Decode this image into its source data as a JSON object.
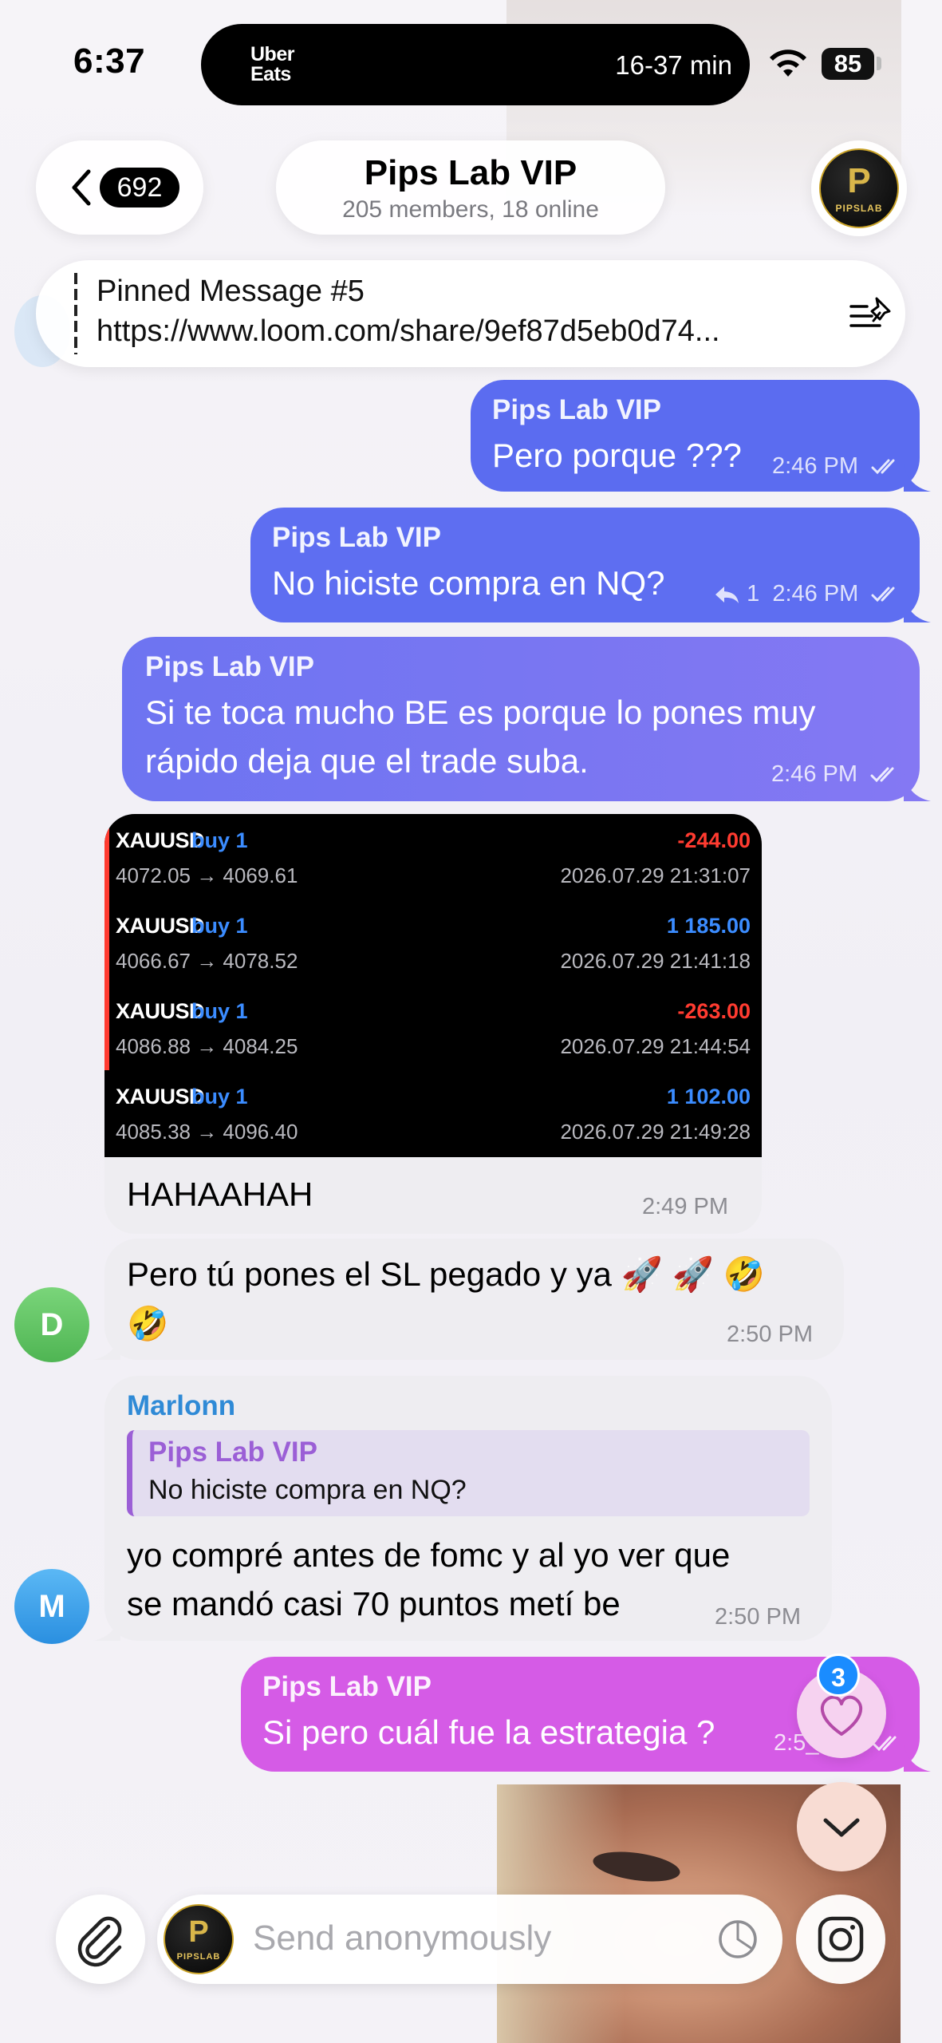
{
  "status_bar": {
    "time": "6:37",
    "live_activity_app": "Uber Eats",
    "eta": "16-37 min",
    "battery": "85"
  },
  "header": {
    "back_count": "692",
    "title": "Pips Lab VIP",
    "subtitle": "205 members, 18 online",
    "avatar_text": "PIPSLAB"
  },
  "pinned": {
    "title": "Pinned Message #5",
    "text": "https://www.loom.com/share/9ef87d5eb0d74..."
  },
  "messages": {
    "m1": {
      "sender": "Pips Lab VIP",
      "text": "Pero porque ???",
      "time": "2:46 PM",
      "color": "#5b6cf0"
    },
    "m2": {
      "sender": "Pips Lab VIP",
      "text": "No hiciste compra en NQ?",
      "replies": "1",
      "time": "2:46 PM",
      "color": "#5e6ef1"
    },
    "m3": {
      "sender": "Pips Lab VIP",
      "line1": "Si te toca mucho BE es porque lo pones muy",
      "line2": "rápido deja que el trade suba.",
      "time": "2:46 PM",
      "color": "#7a78f2"
    },
    "m4": {
      "caption": "HAHAAHAH",
      "time": "2:49 PM",
      "trades": [
        {
          "symbol": "XAUUSD",
          "side": "buy 1",
          "prices": "4072.05 → 4069.61",
          "pnl": "-244.00",
          "date": "2026.07.29 21:31:07",
          "pnl_color": "#ff3b30"
        },
        {
          "symbol": "XAUUSD",
          "side": "buy 1",
          "prices": "4066.67 → 4078.52",
          "pnl": "1 185.00",
          "date": "2026.07.29 21:41:18",
          "pnl_color": "#3b8cff"
        },
        {
          "symbol": "XAUUSD",
          "side": "buy 1",
          "prices": "4086.88 → 4084.25",
          "pnl": "-263.00",
          "date": "2026.07.29 21:44:54",
          "pnl_color": "#ff3b30"
        },
        {
          "symbol": "XAUUSD",
          "side": "buy 1",
          "prices": "4085.38 → 4096.40",
          "pnl": "1 102.00",
          "date": "2026.07.29 21:49:28",
          "pnl_color": "#3b8cff"
        }
      ]
    },
    "m5": {
      "avatar": "D",
      "line1": "Pero tú pones el SL pegado y ya 🚀 🚀 🤣",
      "line2": "🤣",
      "time": "2:50 PM"
    },
    "m6": {
      "avatar": "M",
      "sender": "Marlonn",
      "reply_sender": "Pips Lab VIP",
      "reply_text": "No hiciste compra en NQ?",
      "line1": "yo compré antes de fomc y al yo ver que",
      "line2": "se mandó casi 70 puntos metí be",
      "time": "2:50 PM"
    },
    "m7": {
      "sender": "Pips Lab VIP",
      "text": "Si pero cuál fue la estrategia ?",
      "time": "2:5_ PM",
      "color": "#d55be6"
    }
  },
  "floating": {
    "reactions_badge": "3"
  },
  "composer": {
    "placeholder": "Send anonymously"
  },
  "icons": [
    "chevron-left-icon",
    "pin-list-icon",
    "double-check-icon",
    "reply-icon",
    "heart-icon",
    "chevron-down-icon",
    "paperclip-icon",
    "timer-icon",
    "instagram-icon",
    "wifi-icon",
    "battery-icon"
  ]
}
